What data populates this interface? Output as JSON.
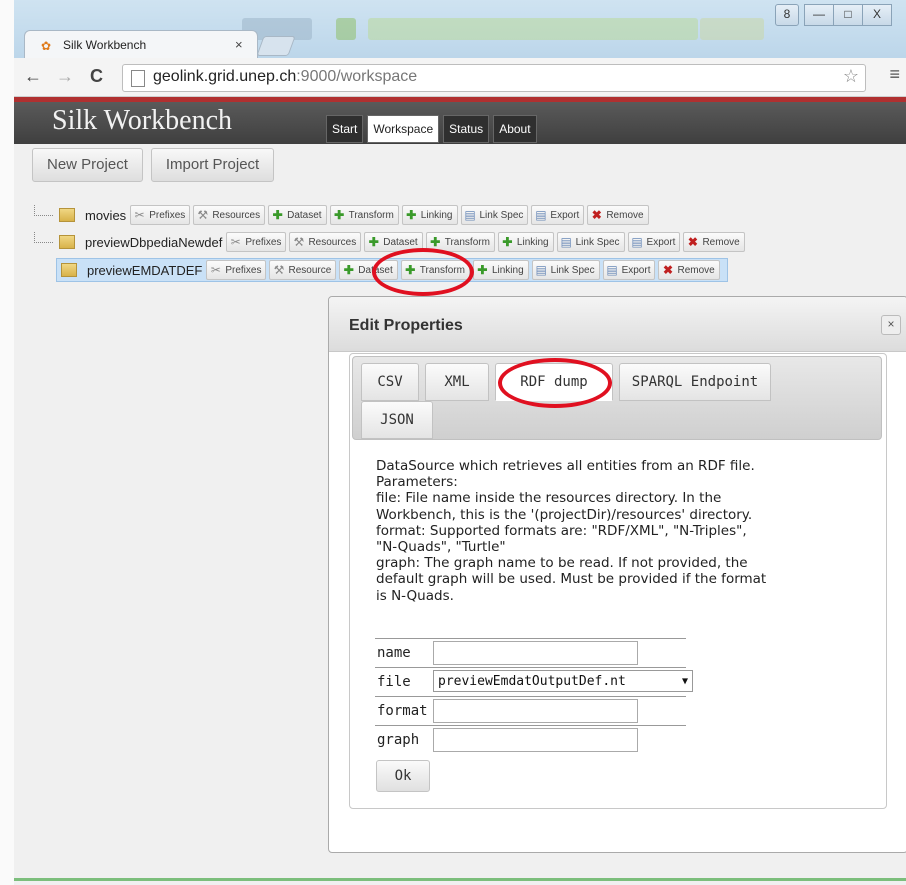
{
  "browser": {
    "tab_title": "Silk Workbench",
    "tab_close": "×",
    "url_host": "geolink.grid.unep.ch",
    "url_rest": ":9000/workspace",
    "back": "←",
    "forward": "→",
    "reload": "C",
    "star": "☆",
    "menu": "≡",
    "window_user": "8",
    "window_min": "—",
    "window_max": "□",
    "window_close": "X"
  },
  "app": {
    "title": "Silk Workbench",
    "nav": [
      "Start",
      "Workspace",
      "Status",
      "About"
    ],
    "active_nav": "Workspace",
    "buttons": [
      "New Project",
      "Import Project"
    ]
  },
  "toolbar_labels": {
    "prefixes": "Prefixes",
    "resources": "Resources",
    "resources_short": "Resource",
    "dataset": "Dataset",
    "transform": "Transform",
    "linking": "Linking",
    "link_spec": "Link Spec",
    "export": "Export",
    "remove": "Remove"
  },
  "projects": [
    {
      "name": "movies",
      "selected": false
    },
    {
      "name": "previewDbpediaNewdef",
      "selected": false
    },
    {
      "name": "previewEMDATDEF",
      "selected": true
    }
  ],
  "dialog": {
    "title": "Edit Properties",
    "close": "×",
    "tabs": [
      "CSV",
      "XML",
      "RDF dump",
      "SPARQL Endpoint",
      "JSON"
    ],
    "active_tab": "RDF dump",
    "description_lines": [
      "DataSource which retrieves all entities from an RDF file.",
      "Parameters:",
      "file: File name inside the resources directory. In the",
      "Workbench, this is the '(projectDir)/resources' directory.",
      "format: Supported formats are: \"RDF/XML\", \"N-Triples\",",
      "\"N-Quads\", \"Turtle\"",
      "graph: The graph name to be read. If not provided, the",
      "default graph will be used. Must be provided if the format",
      "is N-Quads."
    ],
    "params": [
      {
        "label": "name",
        "value": ""
      },
      {
        "label": "file",
        "value": "previewEmdatOutputDef.nt"
      },
      {
        "label": "format",
        "value": ""
      },
      {
        "label": "graph",
        "value": ""
      }
    ],
    "ok": "Ok"
  },
  "colors": {
    "annotation": "#e01020",
    "header_bg": "#474747",
    "accent_red": "#b03030"
  }
}
